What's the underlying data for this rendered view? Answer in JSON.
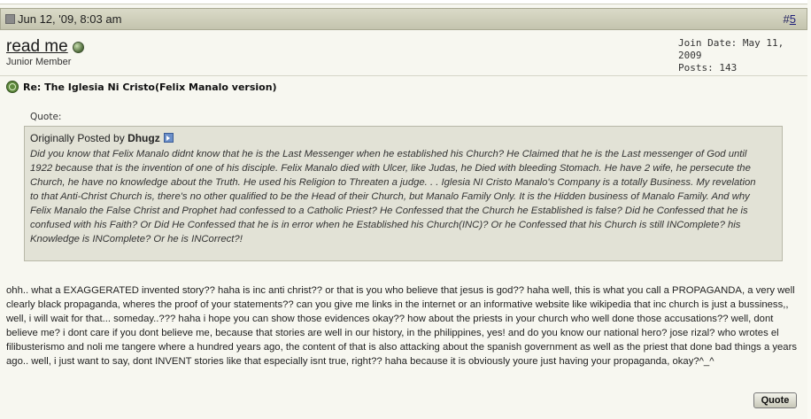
{
  "header": {
    "date": "Jun 12, '09, 8:03 am",
    "post_number_prefix": "#",
    "post_number": "5"
  },
  "user": {
    "username": "read me",
    "title": "Junior Member",
    "join_date": "Join Date: May 11, 2009",
    "posts": "Posts: 143"
  },
  "post": {
    "title": "Re: The Iglesia Ni Cristo(Felix Manalo version)"
  },
  "quote": {
    "label": "Quote:",
    "byline_prefix": "Originally Posted by ",
    "author": "Dhugz",
    "text": "Did you know that Felix Manalo didnt know that he is the Last Messenger when he established his Church? He Claimed that he is the Last messenger of God until 1922 because that is the invention of one of his disciple. Felix Manalo died with Ulcer, like Judas, he Died with bleeding Stomach. He have 2 wife, he persecute the Church, he have no knowledge about the Truth. He used his Religion to Threaten a judge. . . Iglesia NI Cristo Manalo's Company is a totally Business. My revelation to that Anti-Christ Church is, there's no other qualified to be the Head of their Church, but Manalo Family Only. It is the Hidden business of Manalo Family. And why Felix Manalo the False Christ and Prophet had confessed to a Catholic Priest? He Confessed that the Church he Established is false? Did he Confessed that he is confused with his Faith? Or Did He Confessed that he is in error when he Established his Church(INC)? Or he Confessed that his Church is still INComplete? his Knowledge is INComplete? Or he is INCorrect?!"
  },
  "message": {
    "text": "ohh.. what a EXAGGERATED invented story?? haha is inc anti christ?? or that is you who believe that jesus is god?? haha well, this is what you call a PROPAGANDA, a very well clearly black propaganda, wheres the proof of your statements?? can you give me links in the internet or an informative website like wikipedia that inc church is just a bussiness,, well, i will wait for that... someday..??? haha i hope you can show those evidences okay?? how about the priests in your church who well done those accusations?? well, dont believe me? i dont care if you dont believe me, because that stories are well in our history, in the philippines, yes! and do you know our national hero? jose rizal? who wrotes el filibusterismo and noli me tangere where a hundred years ago, the content of that is also attacking about the spanish government as well as the priest that done bad things a years ago.. well, i just want to say, dont INVENT stories like that especially isnt true, right?? haha because it is obviously youre just having your propaganda, okay?^_^"
  },
  "actions": {
    "quote_label": "Quote"
  },
  "icons": {
    "post_status": "post-status-icon",
    "online_status": "online-status-icon",
    "post_title": "post-title-icon",
    "view_post": "view-post-icon"
  },
  "colors": {
    "header_bg": "#d2d2be",
    "page_bg": "#f7f7f0",
    "quote_bg": "#e2e2d6",
    "link": "#1f1f7a"
  }
}
